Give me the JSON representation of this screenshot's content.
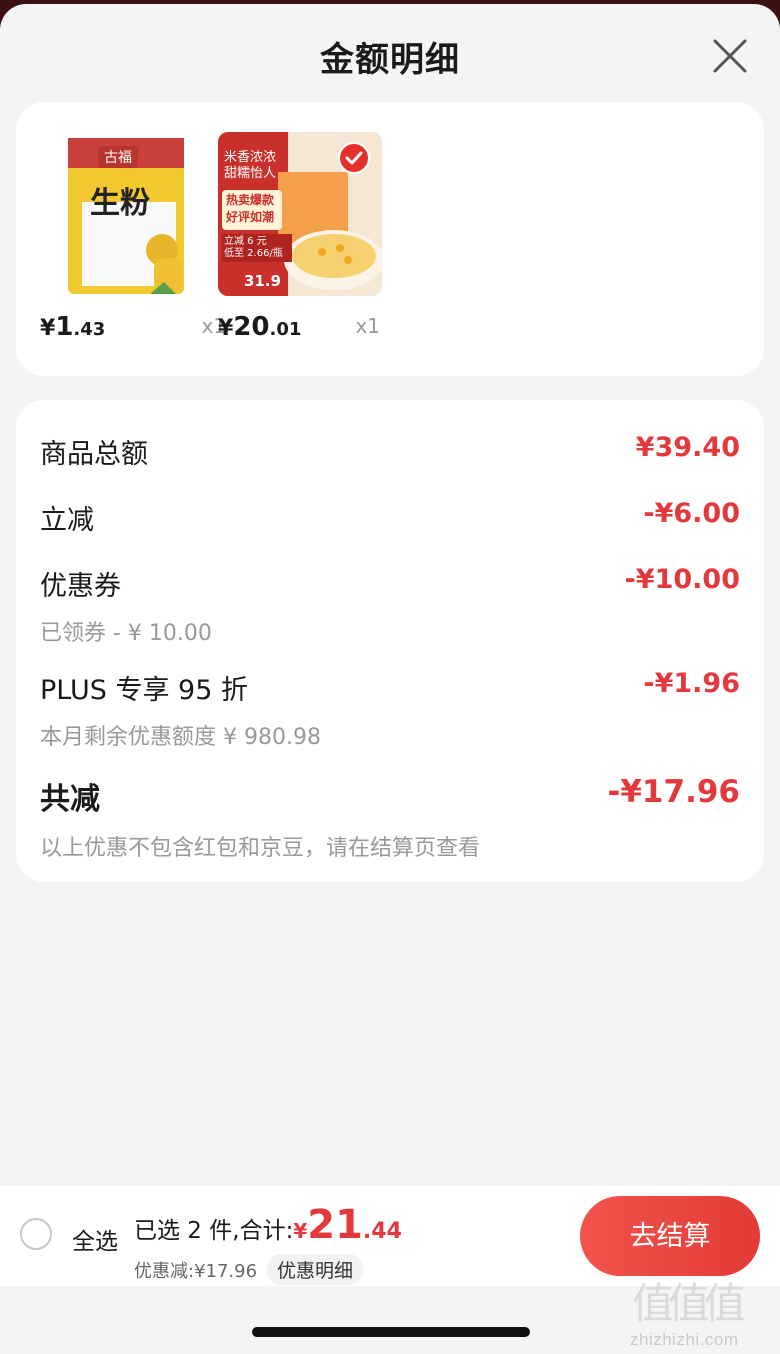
{
  "sheet": {
    "title": "金额明细"
  },
  "products": [
    {
      "price_currency": "¥",
      "price_int": "1",
      "price_dec": ".43",
      "qty": "x1",
      "image": {
        "brand": "古福",
        "name": "生粉"
      }
    },
    {
      "price_currency": "¥",
      "price_int": "20",
      "price_dec": ".01",
      "qty": "x1",
      "image": {
        "line1": "米香浓浓",
        "line2": "甜糯怡人",
        "tag1": "热卖爆款",
        "tag2": "好评如潮",
        "promo1": "立减 6 元",
        "promo2": "低至 2.66/瓶",
        "price": "31.9"
      }
    }
  ],
  "details": {
    "subtotal": {
      "label": "商品总额",
      "amount": "¥39.40"
    },
    "instant": {
      "label": "立减",
      "amount": "-¥6.00"
    },
    "coupon": {
      "label": "优惠券",
      "amount": "-¥10.00",
      "sub": "已领券 - ¥ 10.00"
    },
    "plus": {
      "label": "PLUS 专享 95 折",
      "amount": "-¥1.96",
      "sub": "本月剩余优惠额度 ¥ 980.98"
    },
    "total": {
      "label": "共减",
      "amount": "-¥17.96",
      "sub": "以上优惠不包含红包和京豆，请在结算页查看"
    }
  },
  "footer": {
    "select_all": "全选",
    "selected_text": "已选 2 件,合计:",
    "total_currency": "¥",
    "total_int": "21",
    "total_dec": ".44",
    "discount_text": "优惠减:¥17.96",
    "detail_link": "优惠明细",
    "checkout": "去结算"
  },
  "watermark": {
    "text": "zhizhizhi.com",
    "glyph": "值值值"
  },
  "colors": {
    "accent": "#e4393c",
    "button": "#ef4a44"
  }
}
